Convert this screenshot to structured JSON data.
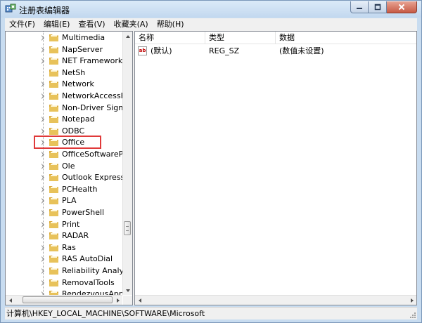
{
  "window": {
    "title": "注册表编辑器",
    "icon": "regedit-icon"
  },
  "menu": [
    {
      "label": "文件(F)"
    },
    {
      "label": "编辑(E)"
    },
    {
      "label": "查看(V)"
    },
    {
      "label": "收藏夹(A)"
    },
    {
      "label": "帮助(H)"
    }
  ],
  "tree": {
    "items": [
      {
        "label": "Multimedia",
        "expandable": true
      },
      {
        "label": "NapServer",
        "expandable": true
      },
      {
        "label": "NET Framework S",
        "expandable": true
      },
      {
        "label": "NetSh",
        "expandable": false
      },
      {
        "label": "Network",
        "expandable": true
      },
      {
        "label": "NetworkAccessPr",
        "expandable": true
      },
      {
        "label": "Non-Driver Signin",
        "expandable": false
      },
      {
        "label": "Notepad",
        "expandable": true
      },
      {
        "label": "ODBC",
        "expandable": true
      },
      {
        "label": "Office",
        "expandable": true,
        "highlighted": true
      },
      {
        "label": "OfficeSoftwarePro",
        "expandable": true
      },
      {
        "label": "Ole",
        "expandable": true
      },
      {
        "label": "Outlook Express",
        "expandable": true
      },
      {
        "label": "PCHealth",
        "expandable": true
      },
      {
        "label": "PLA",
        "expandable": true
      },
      {
        "label": "PowerShell",
        "expandable": true
      },
      {
        "label": "Print",
        "expandable": true
      },
      {
        "label": "RADAR",
        "expandable": true
      },
      {
        "label": "Ras",
        "expandable": true
      },
      {
        "label": "RAS AutoDial",
        "expandable": true
      },
      {
        "label": "Reliability Analysis",
        "expandable": true
      },
      {
        "label": "RemovalTools",
        "expandable": true
      },
      {
        "label": "RendezvousApps",
        "expandable": true
      }
    ],
    "highlight_color": "#e03a3a",
    "folder_color": "#e8c25a"
  },
  "list": {
    "columns": [
      {
        "label": "名称"
      },
      {
        "label": "类型"
      },
      {
        "label": "数据"
      }
    ],
    "rows": [
      {
        "icon_text": "ab",
        "name": "(默认)",
        "type": "REG_SZ",
        "data": "(数值未设置)"
      }
    ]
  },
  "status": {
    "path": "计算机\\HKEY_LOCAL_MACHINE\\SOFTWARE\\Microsoft"
  }
}
